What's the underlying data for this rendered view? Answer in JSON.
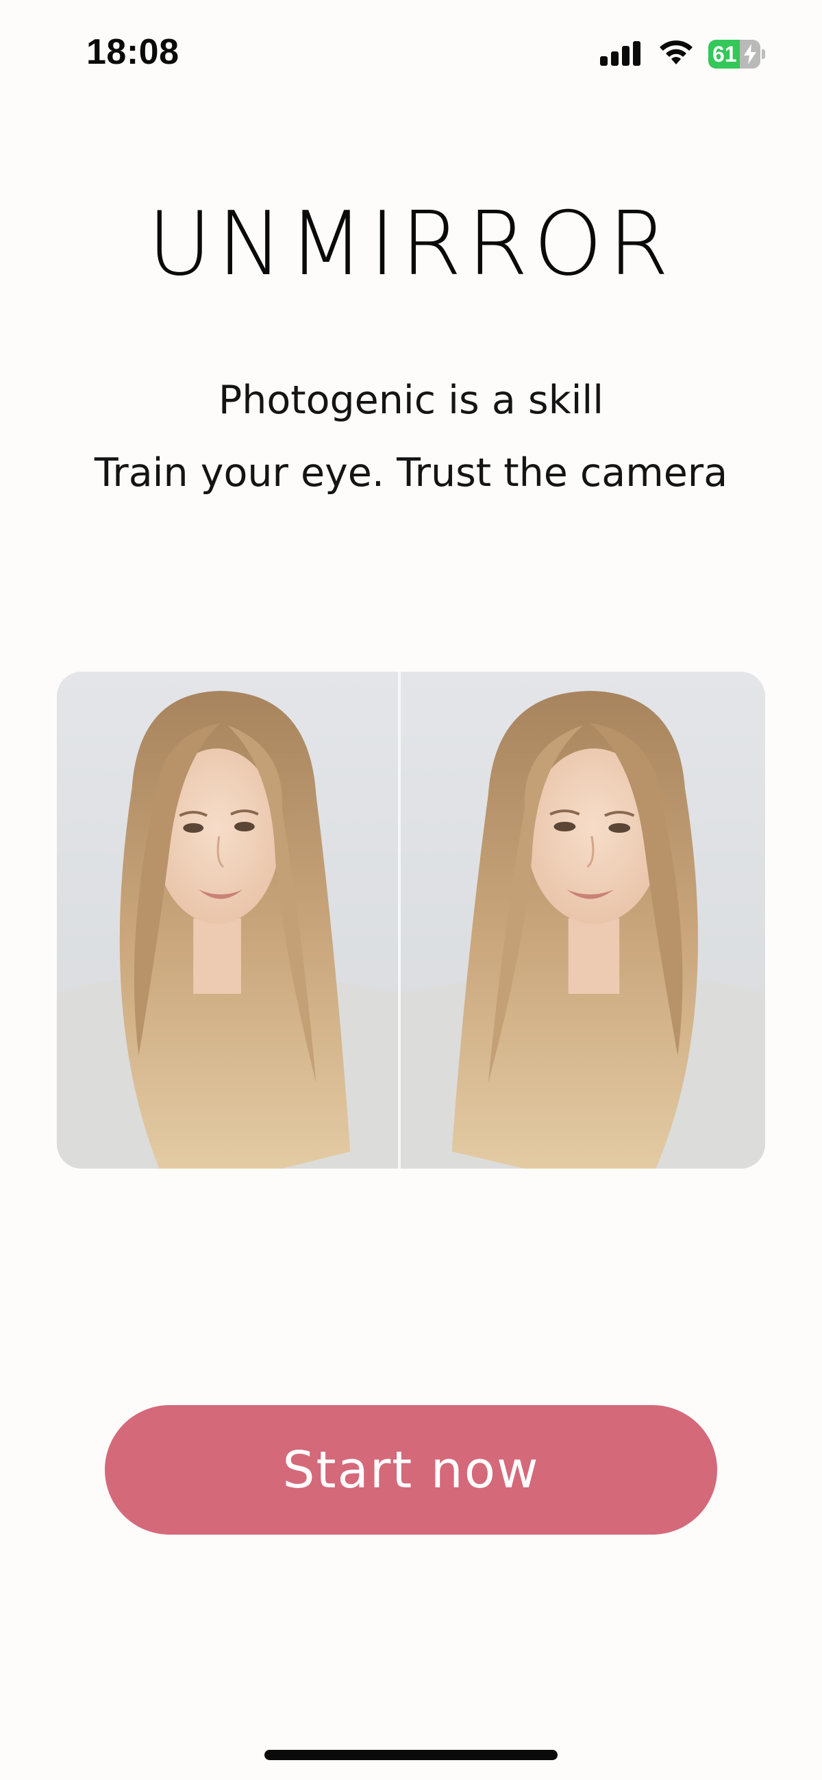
{
  "status_bar": {
    "time": "18:08",
    "battery_percent": "61",
    "battery_level": 0.61,
    "battery_charging": true,
    "icons": [
      "signal-icon",
      "wifi-icon",
      "battery-icon",
      "bolt-icon"
    ]
  },
  "app": {
    "title": "UNMIRROR",
    "tagline_line1": "Photogenic is a skill",
    "tagline_line2": "Train your eye. Trust the camera"
  },
  "comparison": {
    "panels": [
      "portrait-original",
      "portrait-mirrored"
    ]
  },
  "cta": {
    "label": "Start now"
  },
  "colors": {
    "background": "#fdfcfa",
    "accent": "#d4697a",
    "battery_green": "#34c759",
    "text": "#0a0a0a"
  }
}
